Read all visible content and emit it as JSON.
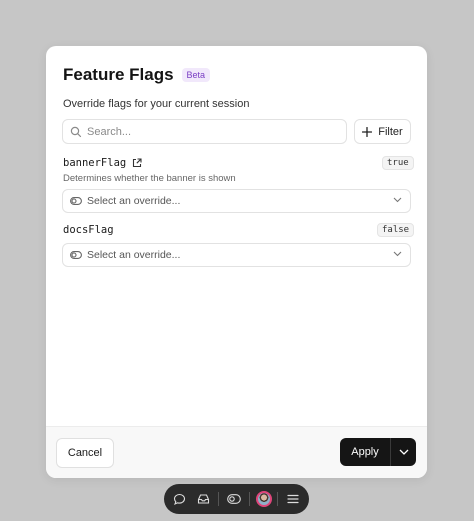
{
  "dialog": {
    "title": "Feature Flags",
    "badge": "Beta",
    "subtitle": "Override flags for your current session"
  },
  "search": {
    "placeholder": "Search...",
    "value": ""
  },
  "filter": {
    "label": "Filter"
  },
  "flags": [
    {
      "name": "bannerFlag",
      "description": "Determines whether the banner is shown",
      "value": "true",
      "select_placeholder": "Select an override..."
    },
    {
      "name": "docsFlag",
      "value": "false",
      "select_placeholder": "Select an override..."
    }
  ],
  "footer": {
    "cancel_label": "Cancel",
    "apply_label": "Apply"
  },
  "toolbar": {
    "icons": [
      "chat-icon",
      "inbox-icon",
      "toggle-icon",
      "avatar",
      "menu-icon"
    ]
  },
  "colors": {
    "backdrop": "#c6c6c6",
    "primary_button": "#151515",
    "beta_badge_text": "#7b3fc4",
    "avatar_ring": "#e0457a"
  }
}
